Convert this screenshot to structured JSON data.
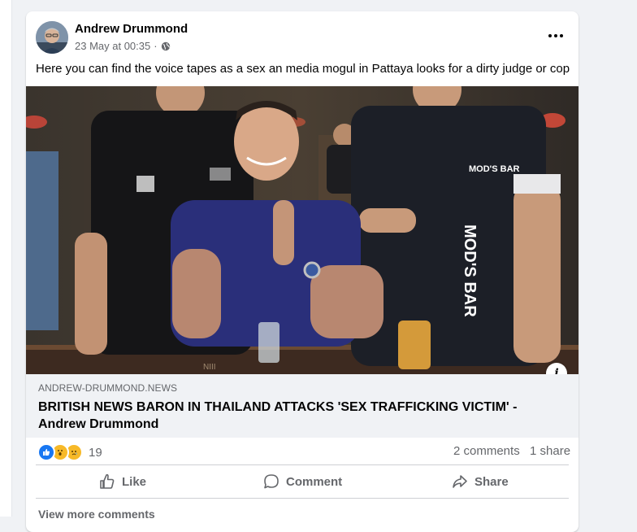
{
  "post": {
    "author": "Andrew Drummond",
    "timestamp": "23 May at 00:35",
    "separator": "·",
    "privacy_icon": "globe-icon",
    "more_icon": "more-options-icon",
    "text": "Here you can find the voice tapes as a sex an media mogul in Pattaya looks for a dirty judge or cop"
  },
  "photo": {
    "shirt_text_left": "MOD'S BAR",
    "shirt_text_right": "MOD'S BAR",
    "counter_text": "NIII"
  },
  "link_preview": {
    "domain": "ANDREW-DRUMMOND.NEWS",
    "title": "BRITISH NEWS BARON IN THAILAND ATTACKS 'SEX TRAFFICKING VICTIM' - Andrew Drummond",
    "info_icon": "i"
  },
  "stats": {
    "reaction_icons": [
      "like-icon",
      "wow-icon",
      "sad-icon"
    ],
    "reaction_count": "19",
    "comments": "2 comments",
    "shares": "1 share"
  },
  "actions": {
    "like": "Like",
    "comment": "Comment",
    "share": "Share"
  },
  "footer": {
    "view_more": "View more comments"
  },
  "colors": {
    "accent": "#1877f2",
    "secondary_text": "#65676b",
    "background": "#f0f2f5"
  }
}
